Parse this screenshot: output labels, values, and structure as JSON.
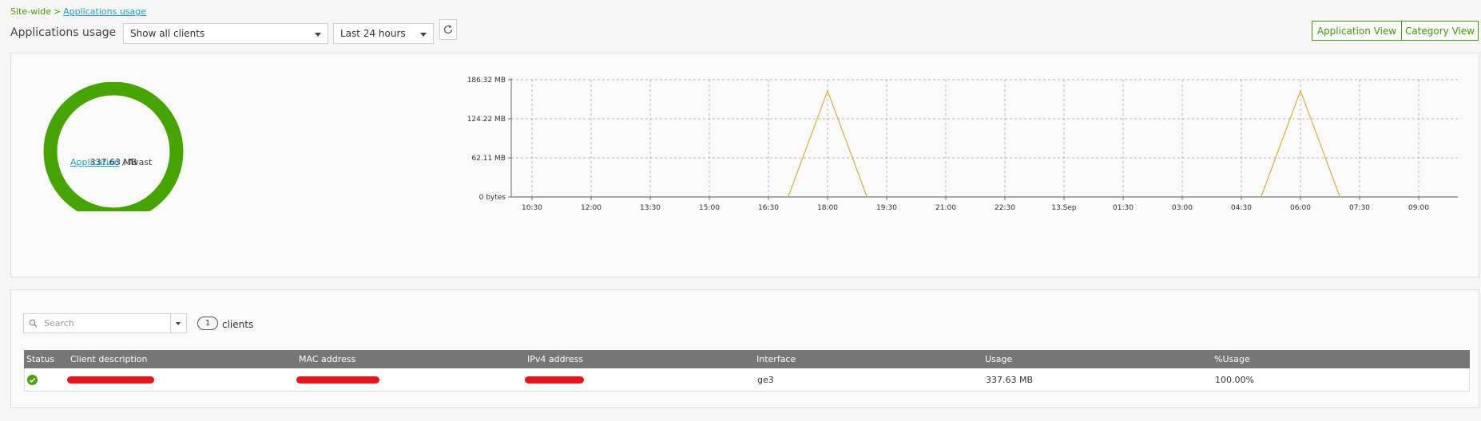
{
  "breadcrumb": {
    "root": "Site-wide",
    "separator": ">",
    "current": "Applications usage"
  },
  "header": {
    "title": "Applications usage",
    "client_filter": "Show all clients",
    "time_range": "Last 24 hours",
    "application_view_label": "Application View",
    "category_view_label": "Category View"
  },
  "donut": {
    "total": "337.63 MB",
    "fraction": 1.0,
    "color": "#46a300",
    "caption_link": "Application",
    "caption_separator": "/",
    "caption_value": "Avast"
  },
  "chart_data": {
    "type": "line",
    "y_ticks": [
      "0 bytes",
      "62.11 MB",
      "124.22 MB",
      "186.32 MB"
    ],
    "ylim": [
      0,
      186.32
    ],
    "x_ticks": [
      "10:30",
      "12:00",
      "13:30",
      "15:00",
      "16:30",
      "18:00",
      "19:30",
      "21:00",
      "22:30",
      "13.Sep",
      "01:30",
      "03:00",
      "04:30",
      "06:00",
      "07:30",
      "09:00"
    ],
    "x_unit_hours": 1.5,
    "grid": true,
    "series": [
      {
        "color": "#e0a52a",
        "points": [
          {
            "x": "17:00",
            "y": 0
          },
          {
            "x": "18:00",
            "y": 168.8
          },
          {
            "x": "19:00",
            "y": 0
          },
          {
            "x": "05:00",
            "y": 0
          },
          {
            "x": "06:00",
            "y": 168.8
          },
          {
            "x": "07:00",
            "y": 0
          }
        ]
      }
    ]
  },
  "table": {
    "search_placeholder": "Search",
    "client_count": "1",
    "client_count_label": "clients",
    "columns": [
      "Status",
      "Client description",
      "MAC address",
      "IPv4 address",
      "Interface",
      "Usage",
      "%Usage"
    ],
    "rows": [
      {
        "status": "online",
        "interface": "ge3",
        "usage": "337.63 MB",
        "pct_usage": "100.00%"
      }
    ]
  },
  "colors": {
    "accent": "#3d9a00",
    "link": "#1a9fd9",
    "header_bg": "#767676",
    "status_ok": "#46a300"
  }
}
